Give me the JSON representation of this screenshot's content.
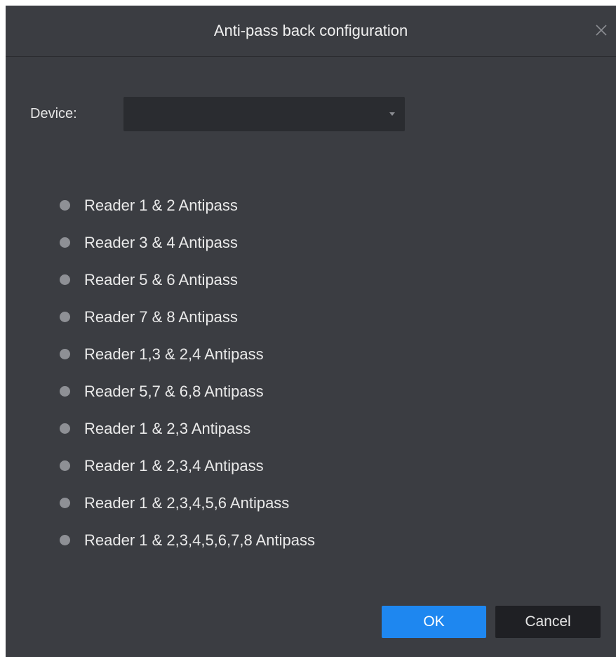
{
  "dialog": {
    "title": "Anti-pass back configuration",
    "close_icon": "close-icon"
  },
  "device": {
    "label": "Device:",
    "selected_value": ""
  },
  "options": [
    {
      "label": "Reader 1 & 2 Antipass",
      "selected": false
    },
    {
      "label": "Reader 3 & 4 Antipass",
      "selected": false
    },
    {
      "label": "Reader 5 & 6 Antipass",
      "selected": false
    },
    {
      "label": "Reader 7 & 8 Antipass",
      "selected": false
    },
    {
      "label": "Reader 1,3 & 2,4 Antipass",
      "selected": false
    },
    {
      "label": "Reader 5,7 & 6,8 Antipass",
      "selected": false
    },
    {
      "label": "Reader 1 & 2,3 Antipass",
      "selected": false
    },
    {
      "label": "Reader 1 & 2,3,4 Antipass",
      "selected": false
    },
    {
      "label": "Reader 1 & 2,3,4,5,6 Antipass",
      "selected": false
    },
    {
      "label": "Reader 1 & 2,3,4,5,6,7,8 Antipass",
      "selected": false
    }
  ],
  "buttons": {
    "ok": "OK",
    "cancel": "Cancel"
  },
  "colors": {
    "background": "#3b3d42",
    "accent": "#1e87f0",
    "input_bg": "#2a2c30",
    "radio": "#8e9095"
  }
}
